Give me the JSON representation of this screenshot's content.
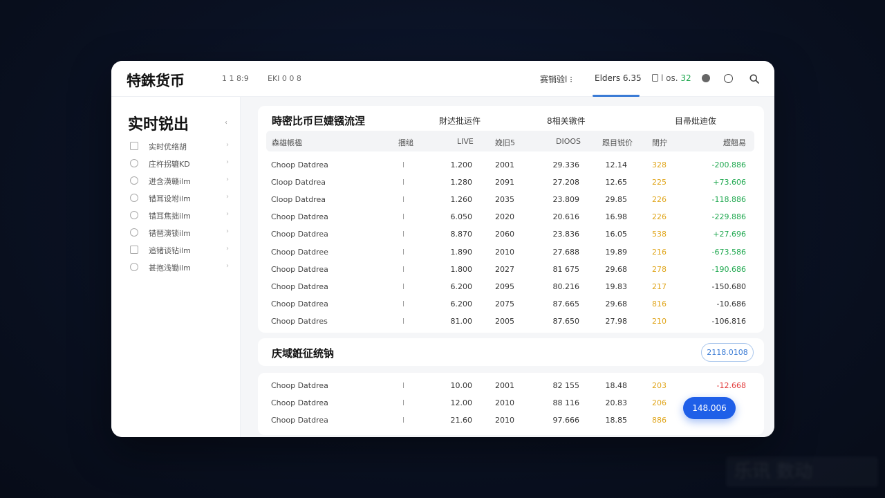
{
  "app": {
    "title": "特銖货币",
    "meta": [
      "1 1 8:9",
      "EKI 0 0 8"
    ]
  },
  "topbar": {
    "menu_1": "赛销验l ⁝",
    "menu_2": "Elders 6.35",
    "menu_3_prefix": "l os.",
    "menu_3_value": "32",
    "colors": {
      "accent": "#3a7bd5",
      "green": "#1fa84f"
    }
  },
  "sidebar": {
    "title": "实时锐出",
    "collapse_icon": "‹",
    "items": [
      {
        "icon": "calendar-icon",
        "label": "实时优络胡"
      },
      {
        "icon": "chat-icon",
        "label": "庄杵拐辘KD"
      },
      {
        "icon": "clock-icon",
        "label": "迸含潢赣ilm"
      },
      {
        "icon": "smile-icon",
        "label": "错耳设坿ilm"
      },
      {
        "icon": "user-icon",
        "label": "错耳焦拙ilm"
      },
      {
        "icon": "face-icon",
        "label": "错琶演锁ilm"
      },
      {
        "icon": "box-icon",
        "label": "追锗谈钻ilm"
      },
      {
        "icon": "gear-icon",
        "label": "甚抱浅锄ilm"
      }
    ]
  },
  "table_card": {
    "title": "時密比币巨婕镪流涅",
    "tabs": [
      "財迖批运仵",
      "8相关镦件",
      "目帚妣迪伖"
    ],
    "headers": [
      "森雄帳楹",
      "捆缒",
      "LIVE",
      "娩旧5",
      "DIOOS",
      "跟目锐价",
      "閉拧",
      "趱翹易"
    ],
    "rows": [
      [
        "Choop Datdrea",
        "l",
        "1.200",
        "2001",
        "29.336",
        "12.14",
        "328",
        "-200.886"
      ],
      [
        "Cloop Datdrea",
        "l",
        "1.280",
        "2091",
        "27.208",
        "12.65",
        "225",
        "+73.606"
      ],
      [
        "Cloop Datdrea",
        "l",
        "1.260",
        "2035",
        "23.809",
        "29.85",
        "226",
        "-118.886"
      ],
      [
        "Choop Datdrea",
        "l",
        "6.050",
        "2020",
        "20.616",
        "16.98",
        "226",
        "-229.886"
      ],
      [
        "Choop Datdrea",
        "l",
        "8.870",
        "2060",
        "23.836",
        "16.05",
        "538",
        "+27.696"
      ],
      [
        "Choop Datdree",
        "l",
        "1.890",
        "2010",
        "27.688",
        "19.89",
        "216",
        "-673.586"
      ],
      [
        "Choop Datdrea",
        "l",
        "1.800",
        "2027",
        "81 675",
        "29.68",
        "278",
        "-190.686"
      ],
      [
        "Choop Datdrea",
        "l",
        "6.200",
        "2095",
        "80.216",
        "19.83",
        "217",
        "-150.680"
      ],
      [
        "Choop Datdrea",
        "l",
        "6.200",
        "2075",
        "87.665",
        "29.68",
        "816",
        "-10.686"
      ],
      [
        "Choop Datdres",
        "l",
        "81.00",
        "2005",
        "87.650",
        "27.98",
        "210",
        "-106.816"
      ]
    ]
  },
  "section2": {
    "title": "庆域銋征统钠",
    "pill_label": "2118.0108"
  },
  "lower_table": {
    "rows": [
      [
        "Choop Datdrea",
        "l",
        "10.00",
        "2001",
        "82 155",
        "18.48",
        "203",
        "-12.668"
      ],
      [
        "Choop Datdrea",
        "l",
        "12.00",
        "2010",
        "88 116",
        "20.83",
        "206",
        ""
      ],
      [
        "Choop Datdrea",
        "l",
        "21.60",
        "2010",
        "97.666",
        "18.85",
        "886",
        ""
      ]
    ]
  },
  "fab": {
    "label": "148.006"
  },
  "value_colors": {
    "positive": "#1fa84f",
    "negative": "#1fa84f",
    "neutral": "#333333",
    "alert": "#e23b3b",
    "highlight": "#e0a51a"
  },
  "watermark": "乐讯 数动"
}
